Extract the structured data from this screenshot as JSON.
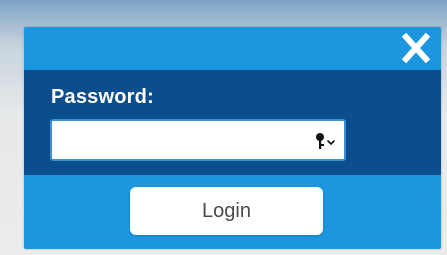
{
  "dialog": {
    "close_icon": "close-icon",
    "password_label": "Password:",
    "password_value": "",
    "password_placeholder": "",
    "password_menu_icon": "key-dropdown-icon",
    "login_label": "Login"
  },
  "colors": {
    "dialog_bg": "#1c96df",
    "field_band_bg": "#0b4e8e",
    "input_border": "#3f8fd6",
    "button_bg": "#ffffff",
    "button_text": "#4a4a4a"
  }
}
